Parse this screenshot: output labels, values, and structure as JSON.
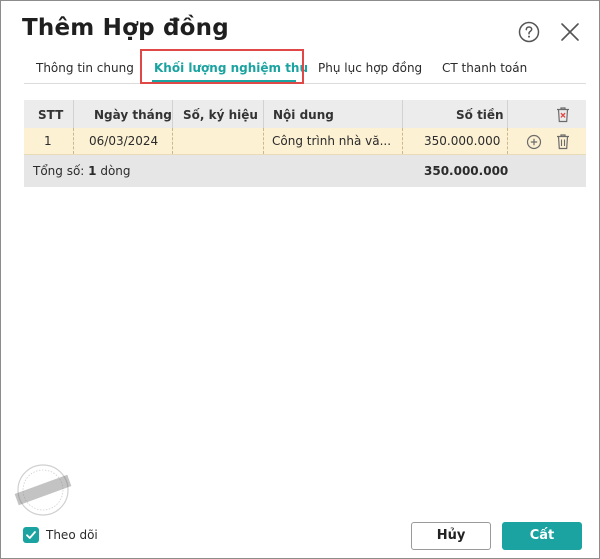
{
  "dialog": {
    "title": "Thêm Hợp đồng",
    "help_icon": "help-circle-icon",
    "close_icon": "close-icon"
  },
  "tabs": [
    {
      "label": "Thông tin chung",
      "active": false
    },
    {
      "label": "Khối lượng nghiệm thu",
      "active": true
    },
    {
      "label": "Phụ lục hợp đồng",
      "active": false
    },
    {
      "label": "CT thanh toán",
      "active": false
    }
  ],
  "table": {
    "headers": [
      "STT",
      "Ngày tháng",
      "Số, ký hiệu",
      "Nội dung",
      "Số tiền"
    ],
    "header_action_icon": "delete-all-icon",
    "rows": [
      {
        "stt": "1",
        "date": "06/03/2024",
        "code": "",
        "content": "Công trình nhà vă...",
        "amount": "350.000.000"
      }
    ],
    "row_action_icons": [
      "add-icon",
      "trash-icon"
    ],
    "footer": {
      "total_label": "Tổng số: ",
      "total_count": "1",
      "total_unit": " dòng",
      "total_amount": "350.000.000"
    }
  },
  "footer": {
    "follow_label": "Theo dõi",
    "follow_checked": true,
    "cancel_label": "Hủy",
    "save_label": "Cất"
  },
  "watermark": {
    "text": "DỮ LIỆU MẪU"
  },
  "colors": {
    "accent": "#1aa3a0",
    "highlight": "#e04848",
    "row_selected": "#fdf1d4"
  }
}
